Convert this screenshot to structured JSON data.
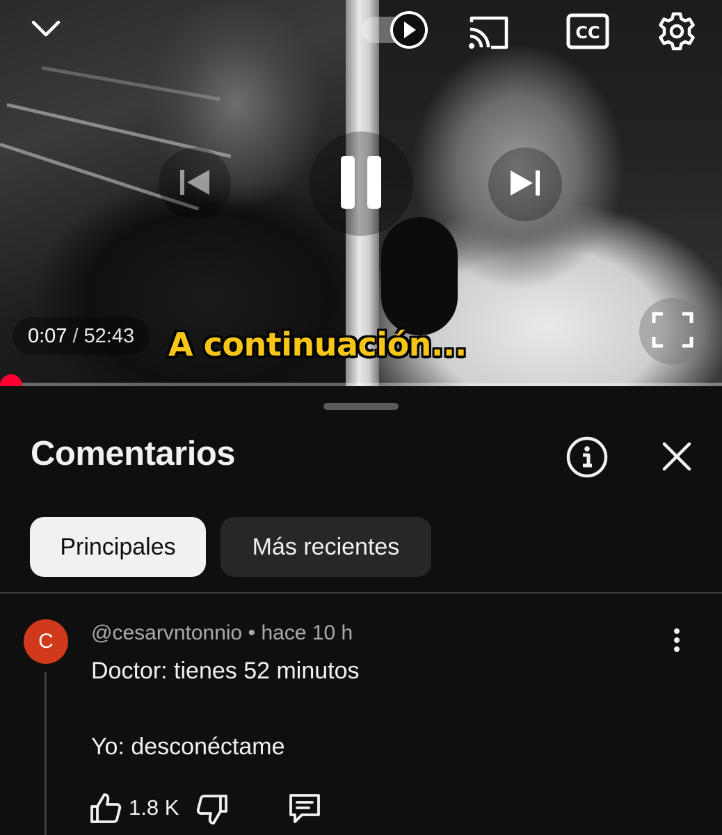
{
  "player": {
    "current_time": "0:07",
    "time_separator": "/",
    "duration": "52:43",
    "caption": "A continuación...",
    "progress_fraction": 0.0022,
    "icons": {
      "minimize": "chevron-down-icon",
      "autoplay": "autoplay-toggle-icon",
      "cast": "cast-icon",
      "captions": "cc-icon",
      "settings": "gear-icon",
      "previous": "skip-previous-icon",
      "pause": "pause-icon",
      "next": "skip-next-icon",
      "fullscreen": "fullscreen-icon"
    },
    "captions_icon_label": "CC",
    "progress_color": "#ff0033"
  },
  "comments": {
    "title": "Comentarios",
    "icons": {
      "info": "info-icon",
      "close": "close-icon"
    },
    "filters": [
      {
        "label": "Principales",
        "selected": true
      },
      {
        "label": "Más recientes",
        "selected": false
      }
    ],
    "items": [
      {
        "avatar_letter": "C",
        "avatar_color": "#d0391b",
        "author": "@cesarvntonnio",
        "meta_separator": "•",
        "age": "hace 10 h",
        "text_lines": [
          "Doctor: tienes 52 minutos",
          "Yo: desconéctame"
        ],
        "likes": "1.8 K",
        "icons": {
          "like": "thumbs-up-icon",
          "dislike": "thumbs-down-icon",
          "reply": "reply-icon",
          "more": "more-vert-icon"
        }
      }
    ]
  }
}
